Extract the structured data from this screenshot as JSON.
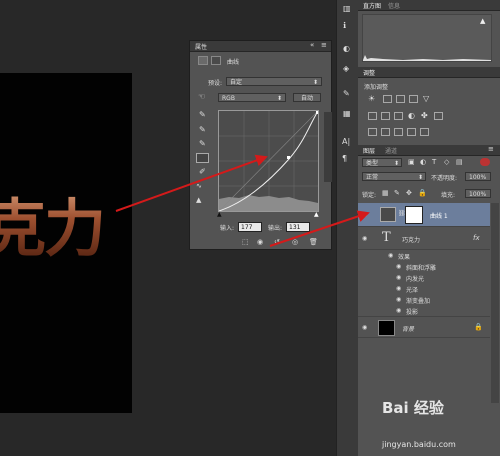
{
  "document": {
    "text": "克力"
  },
  "properties": {
    "tab_title": "属性",
    "panel_name": "曲线",
    "preset_label": "预设:",
    "preset_value": "自定",
    "channel_value": "RGB",
    "auto_label": "自动",
    "input_label": "输入:",
    "input_value": "177",
    "output_label": "输出:",
    "output_value": "131"
  },
  "right_top": {
    "tabs": [
      "直方图",
      "信息"
    ],
    "warning": "▲"
  },
  "adjustments": {
    "tabs": [
      "调整"
    ],
    "add_label": "添加调整"
  },
  "layers": {
    "tabs": [
      "图层",
      "通道"
    ],
    "filter_kind": "类型",
    "blend_mode": "正常",
    "opacity_label": "不透明度:",
    "opacity_value": "100%",
    "lock_label": "锁定:",
    "fill_label": "填充:",
    "fill_value": "100%",
    "items": [
      {
        "name": "曲线 1"
      },
      {
        "name": "巧克力",
        "fx": "fx"
      },
      {
        "name": "效果"
      },
      {
        "name": "斜面和浮雕"
      },
      {
        "name": "内发光"
      },
      {
        "name": "光泽"
      },
      {
        "name": "渐变叠加"
      },
      {
        "name": "投影"
      },
      {
        "name": "背景"
      }
    ]
  },
  "watermark": {
    "brand": "Bai 经验",
    "url": "jingyan.baidu.com"
  },
  "colors": {
    "arrow": "#d41a1a",
    "selected_layer": "#6c7e9c",
    "panel": "#535353"
  }
}
